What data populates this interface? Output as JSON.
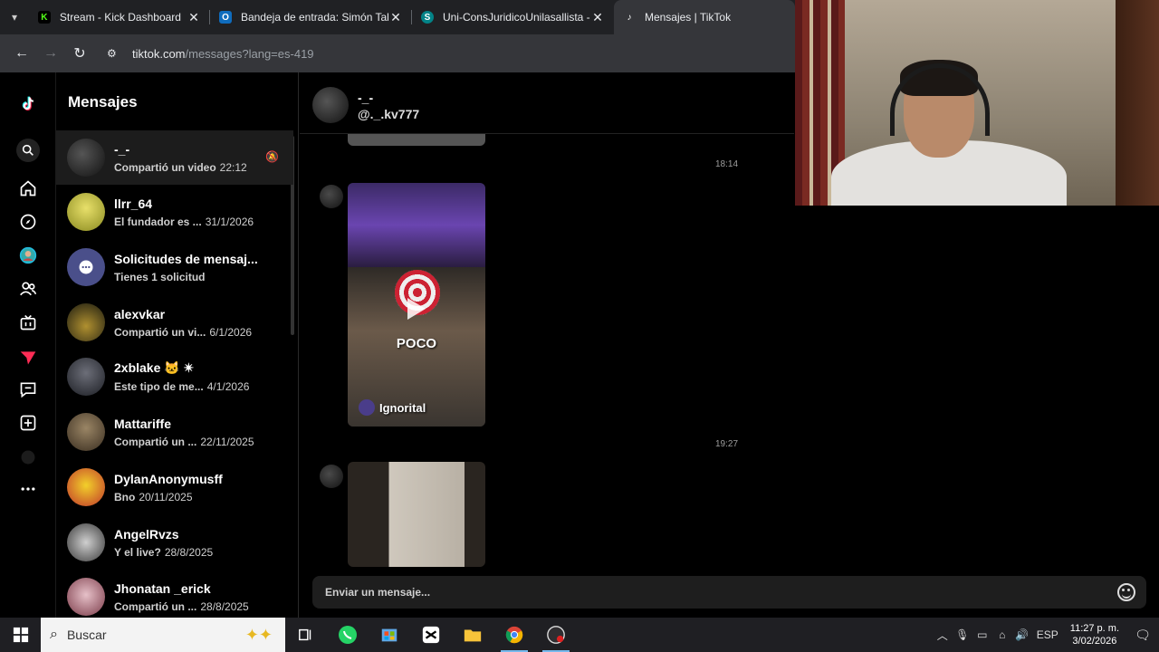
{
  "browser": {
    "tabs": [
      {
        "title": "Stream - Kick Dashboard",
        "icon": "kick-icon",
        "color": "#53fc18",
        "active": false
      },
      {
        "title": "Bandeja de entrada: Simón Tab",
        "icon": "outlook-icon",
        "color": "#0f6cbd",
        "active": false
      },
      {
        "title": "Uni-ConsJuridicoUnilasallista - (",
        "icon": "sharepoint-icon",
        "color": "#038387",
        "active": false
      },
      {
        "title": "Mensajes | TikTok",
        "icon": "tiktok-icon",
        "color": "#ffffff",
        "active": true
      }
    ],
    "url_host": "tiktok.com",
    "url_rest": "/messages?lang=es-419"
  },
  "sidebar_title": "Mensajes",
  "conversations": [
    {
      "name": "-_-",
      "preview": "Compartió un video",
      "date": "22:12",
      "avatar_color": "#2b2b2b",
      "muted": true
    },
    {
      "name": "llrr_64",
      "preview": "El fundador es ...",
      "date": "31/1/2026",
      "avatar_color": "#d4c832"
    },
    {
      "name": "Solicitudes de mensaj...",
      "preview": "Tienes 1 solicitud",
      "date": "",
      "avatar_color": "#4a4f8a"
    },
    {
      "name": "alexvkar",
      "preview": "Compartió un vi...",
      "date": "6/1/2026",
      "avatar_color": "#4b4633"
    },
    {
      "name": "2xblake 🐱 ✴",
      "preview": "Este tipo de me...",
      "date": "4/1/2026",
      "avatar_color": "#2e3038"
    },
    {
      "name": "Mattariffe",
      "preview": "Compartió un ...",
      "date": "22/11/2025",
      "avatar_color": "#6a5a45"
    },
    {
      "name": "DylanAnonymusff",
      "preview": "Bno",
      "date": "20/11/2025",
      "avatar_color": "#d9a51c"
    },
    {
      "name": "AngelRvzs",
      "preview": "Y el live?",
      "date": "28/8/2025",
      "avatar_color": "#7b7b7b"
    },
    {
      "name": "Jhonatan _erick",
      "preview": "Compartió un ...",
      "date": "28/8/2025",
      "avatar_color": "#a8707a"
    }
  ],
  "chat": {
    "name": "-_-",
    "handle": "@._.kv777",
    "timestamps": [
      "18:14",
      "19:27"
    ],
    "card_text": "POCO",
    "card_author": "Ignorital",
    "composer_placeholder": "Enviar un mensaje..."
  },
  "taskbar": {
    "search_placeholder": "Buscar",
    "language": "ESP",
    "time": "11:27 p. m.",
    "date": "3/02/2026"
  }
}
